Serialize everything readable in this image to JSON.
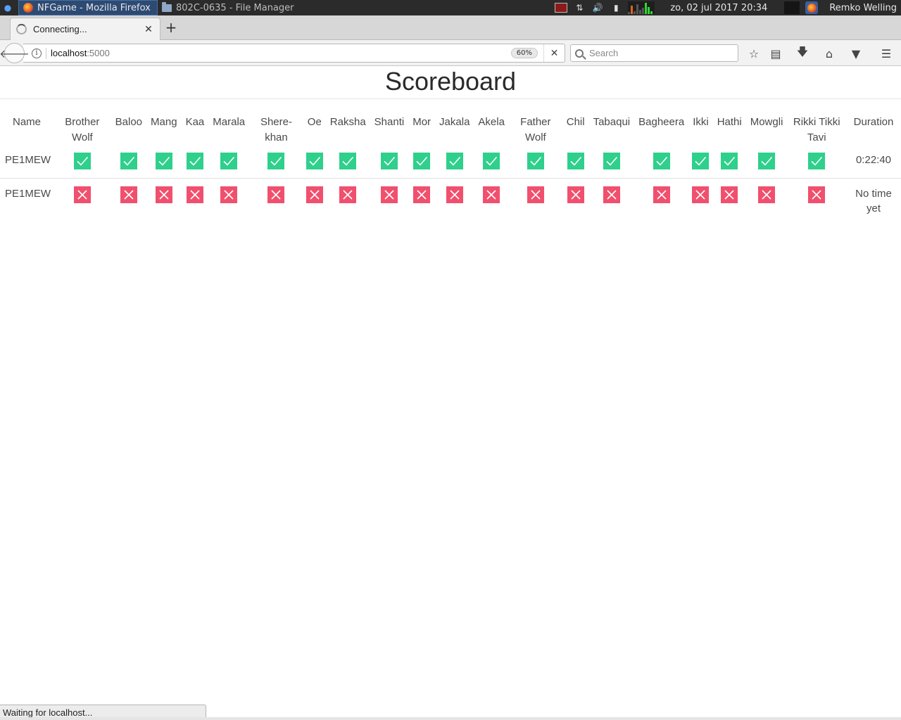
{
  "panel": {
    "tasks": [
      {
        "label": "NFGame - Mozilla Firefox",
        "active": true
      },
      {
        "label": "802C-0635 - File Manager",
        "active": false
      }
    ],
    "clock": "zo, 02 jul 2017 20:34",
    "username": "Remko Welling",
    "colors": {
      "background": "#2b2b2b",
      "active_task": "#2d4a73"
    }
  },
  "browser": {
    "tab_title": "Connecting...",
    "url_host": "localhost",
    "url_port": ":5000",
    "zoom": "60%",
    "search_placeholder": "Search",
    "status_text": "Waiting for localhost...",
    "icons": [
      "back-arrow-icon",
      "info-icon",
      "stop-icon",
      "search-icon",
      "bookmark-star-icon",
      "reading-list-icon",
      "download-icon",
      "home-icon",
      "pocket-icon",
      "hamburger-menu-icon"
    ]
  },
  "scoreboard": {
    "title": "Scoreboard",
    "columns": [
      "Name",
      "Brother Wolf",
      "Baloo",
      "Mang",
      "Kaa",
      "Marala",
      "Shere-khan",
      "Oe",
      "Raksha",
      "Shanti",
      "Mor",
      "Jakala",
      "Akela",
      "Father Wolf",
      "Chil",
      "Tabaqui",
      "Bagheera",
      "Ikki",
      "Hathi",
      "Mowgli",
      "Rikki Tikki Tavi",
      "Duration"
    ],
    "rows": [
      {
        "name": "PE1MEW",
        "marks": [
          true,
          true,
          true,
          true,
          true,
          true,
          true,
          true,
          true,
          true,
          true,
          true,
          true,
          true,
          true,
          true,
          true,
          true,
          true,
          true
        ],
        "duration": "0:22:40"
      },
      {
        "name": "PE1MEW",
        "marks": [
          false,
          false,
          false,
          false,
          false,
          false,
          false,
          false,
          false,
          false,
          false,
          false,
          false,
          false,
          false,
          false,
          false,
          false,
          false,
          false
        ],
        "duration": "No time yet"
      }
    ],
    "colors": {
      "ok": "#2ed08c",
      "fail": "#f0506e"
    }
  }
}
